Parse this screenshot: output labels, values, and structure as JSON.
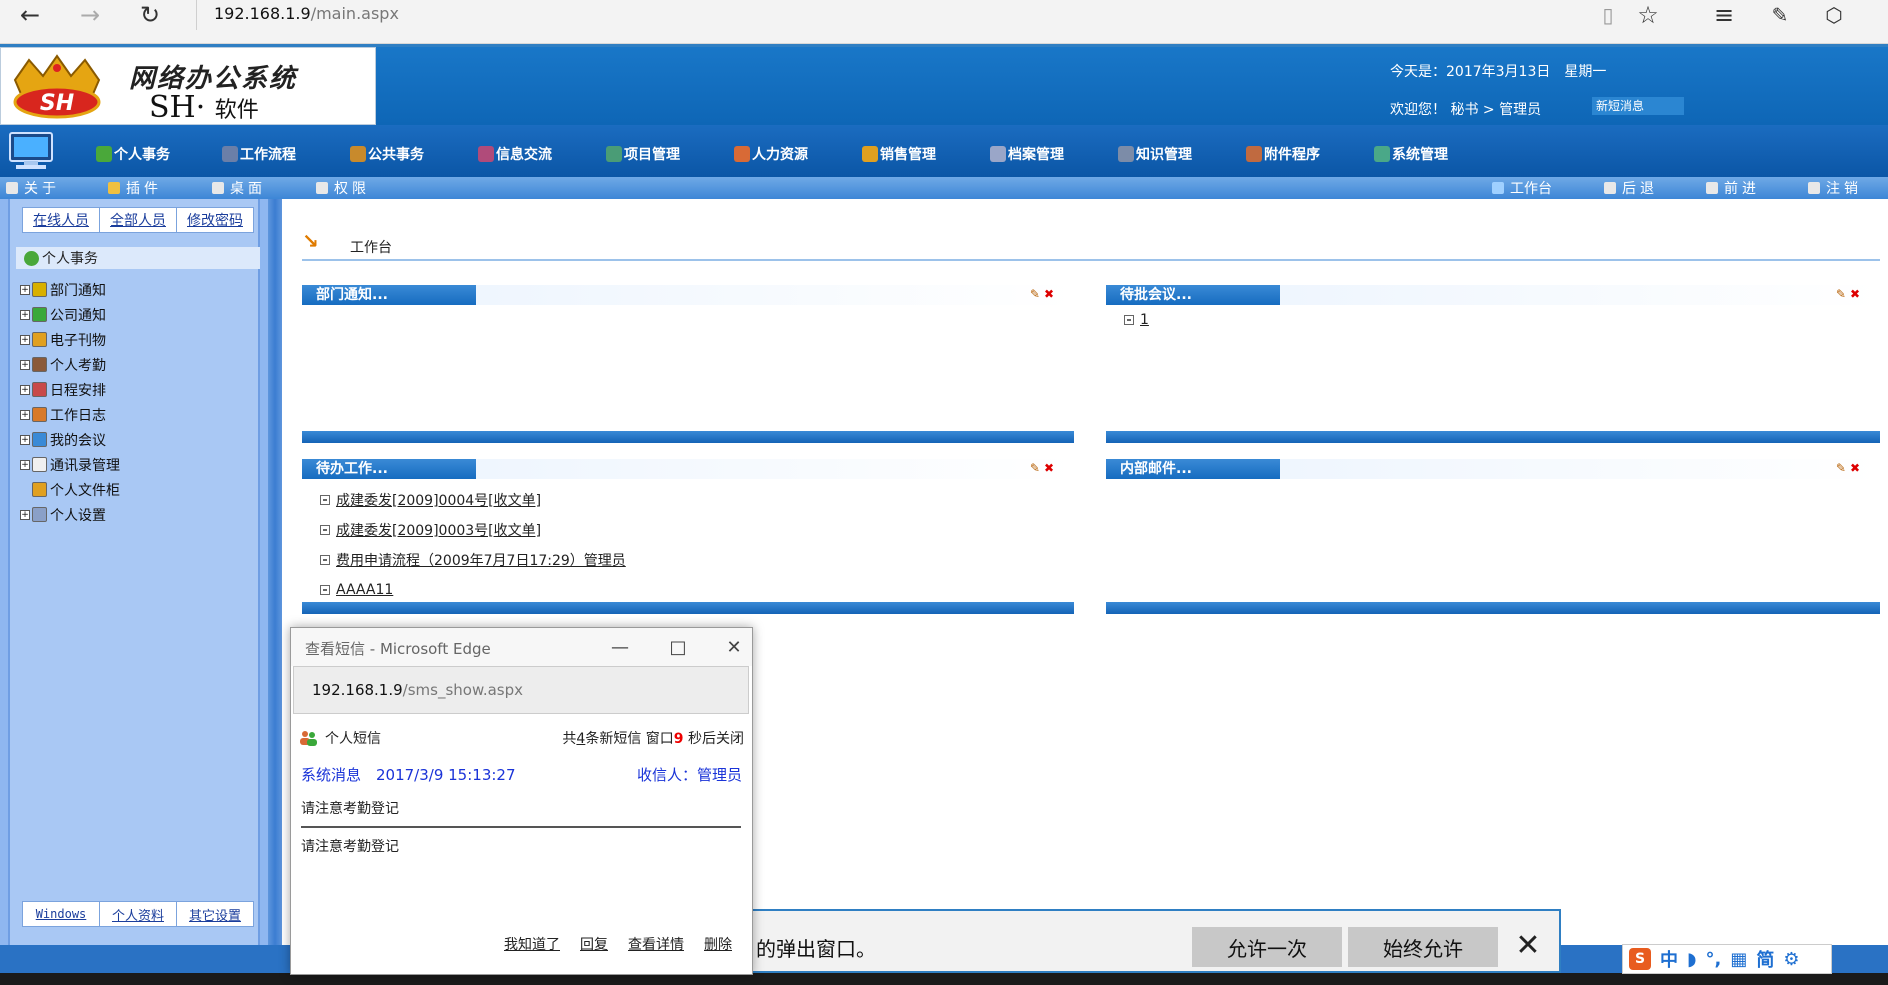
{
  "browser": {
    "url_host": "192.168.1.9",
    "url_path": "/main.aspx"
  },
  "header": {
    "logo_badge": "SH",
    "logo_title": "网络办公系统",
    "logo_sub_main": "SH·",
    "logo_sub_soft": "软件",
    "date_text": "今天是：2017年3月13日　星期一",
    "welcome_text": "欢迎您！ 秘书 > 管理员",
    "new_message": "新短消息"
  },
  "nav": {
    "items": [
      {
        "label": "个人事务",
        "color": "#4aa83a"
      },
      {
        "label": "工作流程",
        "color": "#6b7fa8"
      },
      {
        "label": "公共事务",
        "color": "#c88a2c"
      },
      {
        "label": "信息交流",
        "color": "#b04b7a"
      },
      {
        "label": "项目管理",
        "color": "#4a9c76"
      },
      {
        "label": "人力资源",
        "color": "#d86a36"
      },
      {
        "label": "销售管理",
        "color": "#e0a020"
      },
      {
        "label": "档案管理",
        "color": "#9aa6c8"
      },
      {
        "label": "知识管理",
        "color": "#7c8ca8"
      },
      {
        "label": "附件程序",
        "color": "#c06a40"
      },
      {
        "label": "系统管理",
        "color": "#4aa888"
      }
    ]
  },
  "toolbar": {
    "left": [
      "关于",
      "插件",
      "桌面",
      "权限"
    ],
    "right": [
      "工作台",
      "后退",
      "前进",
      "注销"
    ]
  },
  "sidebar": {
    "top_tabs": [
      "在线人员",
      "全部人员",
      "修改密码"
    ],
    "root": "个人事务",
    "tree": [
      {
        "label": "部门通知",
        "color": "#d8b000",
        "expandable": true
      },
      {
        "label": "公司通知",
        "color": "#3aa83a",
        "expandable": true
      },
      {
        "label": "电子刊物",
        "color": "#e0a020",
        "expandable": true
      },
      {
        "label": "个人考勤",
        "color": "#8a5a3a",
        "expandable": true
      },
      {
        "label": "日程安排",
        "color": "#c84a4a",
        "expandable": true
      },
      {
        "label": "工作日志",
        "color": "#d87a2a",
        "expandable": true
      },
      {
        "label": "我的会议",
        "color": "#3a8ad6",
        "expandable": true
      },
      {
        "label": "通讯录管理",
        "color": "#f0f0f0",
        "expandable": true
      },
      {
        "label": "个人文件柜",
        "color": "#e0a020",
        "expandable": false
      },
      {
        "label": "个人设置",
        "color": "#8aa0c8",
        "expandable": true
      }
    ],
    "bottom_tabs": [
      "Windows",
      "个人资料",
      "其它设置"
    ]
  },
  "main": {
    "title": "工作台",
    "panels": {
      "dept_notice": {
        "title": "部门通知...",
        "items": []
      },
      "pending_meeting": {
        "title": "待批会议...",
        "items": [
          "1"
        ]
      },
      "todo": {
        "title": "待办工作...",
        "items": [
          "成建委发[2009]0004号[收文单]",
          "成建委发[2009]0003号[收文单]",
          "费用申请流程（2009年7月7日17:29）管理员",
          "AAAA11"
        ]
      },
      "internal_mail": {
        "title": "内部邮件...",
        "items": []
      }
    },
    "panel_edit": "✎",
    "panel_close": "✖"
  },
  "permission_bar": {
    "text": "的弹出窗口。",
    "allow_once": "允许一次",
    "always_allow": "始终允许"
  },
  "ime": {
    "logo": "S",
    "items": [
      "中",
      "◗",
      "°,",
      "▦",
      "简",
      "⚙"
    ]
  },
  "popup": {
    "title": "查看短信 - Microsoft Edge",
    "url_host": "192.168.1.9",
    "url_path": "/sms_show.aspx",
    "heading": "个人短信",
    "count_prefix": "共",
    "count_num": "4",
    "count_mid": "条新短信 窗口",
    "countdown": "9",
    "count_suffix": " 秒后关闭",
    "sender": "系统消息　2017/3/9 15:13:27",
    "receiver": "收信人：管理员",
    "subject": "请注意考勤登记",
    "content": "请注意考勤登记",
    "actions": [
      "我知道了",
      "回复",
      "查看详情",
      "删除"
    ]
  }
}
